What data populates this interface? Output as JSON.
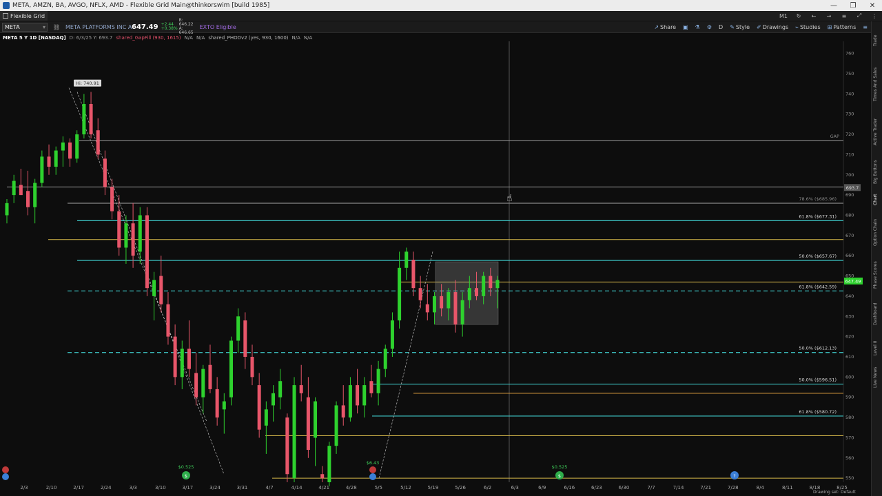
{
  "window": {
    "title": "META, AMZN, BA, AVGO, NFLX, AMD - Flexible Grid Main@thinkorswim [build 1985]",
    "minimize": "—",
    "restore": "❐",
    "close": "✕"
  },
  "menubar": {
    "grid_label": "Flexible Grid",
    "icons": [
      "M1",
      "↻",
      "←",
      "→",
      "≡",
      "⤢",
      "⋮"
    ]
  },
  "toolbar": {
    "symbol": "META",
    "company": "META PLATFORMS INC A",
    "last": "647.49",
    "change_abs": "+2.44",
    "change_pct": "+0.38%",
    "bid": "B: 646.22",
    "ask": "A: 646.65",
    "ext": "EXTO Eligible",
    "share": "Share",
    "style": "Style",
    "drawings": "Drawings",
    "studies": "Studies",
    "patterns": "Patterns",
    "timeframe": "D"
  },
  "chart_header": {
    "symbol": "META 5 Y 1D [NASDAQ]",
    "ohlc": "D: 6/3/25  Y: 693.7",
    "study1": "shared_GapFill (930, 1615)",
    "na1": "N/A",
    "na2": "N/A",
    "study2": "shared_PHODv2 (yes, 930, 1600)",
    "na3": "N/A",
    "na4": "N/A"
  },
  "sidebar": {
    "tabs": [
      "Trade",
      "Times And Sales",
      "Active Trader",
      "Big Buttons",
      "Chart",
      "Option Chain",
      "Phase Scores",
      "Dashboard",
      "Level II",
      "Live News"
    ]
  },
  "chart_data": {
    "type": "candlestick",
    "price_axis": {
      "ylim": [
        548,
        766
      ],
      "ticks": [
        550,
        560,
        570,
        580,
        590,
        600,
        610,
        620,
        630,
        640,
        650,
        660,
        670,
        680,
        690,
        700,
        710,
        720,
        730,
        740,
        750,
        760
      ]
    },
    "date_ticks": [
      "2/3",
      "2/10",
      "2/17",
      "2/24",
      "3/3",
      "3/10",
      "3/17",
      "3/24",
      "3/31",
      "4/7",
      "4/14",
      "4/21",
      "4/28",
      "5/5",
      "5/12",
      "5/19",
      "5/26",
      "6/2",
      "6/3",
      "6/9",
      "6/16",
      "6/23",
      "6/30",
      "7/7",
      "7/14",
      "7/21",
      "7/28",
      "8/4",
      "8/11",
      "8/18",
      "8/25"
    ],
    "high_label": "Hi: 740.91",
    "last_price": "647.49",
    "cursor_price": "693.7",
    "gap_label": "GAP",
    "fib_lines": [
      {
        "label": "78.6% ($685.96)",
        "price": 685.96,
        "color": "#888888",
        "style": "solid"
      },
      {
        "label": "61.8% ($677.31)",
        "price": 677.31,
        "color": "#3ec9c9",
        "style": "solid"
      },
      {
        "label": "50.0% ($657.67)",
        "price": 657.67,
        "color": "#3ec9c9",
        "style": "solid"
      },
      {
        "label": "61.8% ($642.59)",
        "price": 642.59,
        "color": "#3ec9c9",
        "style": "dashed"
      },
      {
        "label": "50.0% ($612.13)",
        "price": 612.13,
        "color": "#3ec9c9",
        "style": "dashed"
      },
      {
        "label": "50.0% ($596.51)",
        "price": 596.51,
        "color": "#3ec9c9",
        "style": "solid"
      },
      {
        "label": "61.8% ($580.72)",
        "price": 580.72,
        "color": "#3ec9c9",
        "style": "solid"
      }
    ],
    "level_lines": [
      {
        "price": 717,
        "color": "#9a9a9a"
      },
      {
        "price": 694,
        "color": "#9a9a9a"
      },
      {
        "price": 668,
        "color": "#d6b84a"
      },
      {
        "price": 647,
        "color": "#d6b84a"
      },
      {
        "price": 592,
        "color": "#e0a040"
      },
      {
        "price": 571,
        "color": "#d6b84a"
      },
      {
        "price": 550,
        "color": "#d6b84a"
      }
    ],
    "candles": [
      [
        680,
        688,
        676,
        686
      ],
      [
        690,
        700,
        686,
        697
      ],
      [
        695,
        703,
        690,
        690
      ],
      [
        692,
        702,
        680,
        684
      ],
      [
        684,
        698,
        676,
        696
      ],
      [
        696,
        712,
        694,
        709
      ],
      [
        709,
        715,
        700,
        704
      ],
      [
        704,
        714,
        700,
        712
      ],
      [
        712,
        719,
        704,
        716
      ],
      [
        716,
        718,
        704,
        708
      ],
      [
        708,
        722,
        706,
        720
      ],
      [
        720,
        740,
        718,
        735
      ],
      [
        735,
        741,
        718,
        720
      ],
      [
        722,
        728,
        708,
        710
      ],
      [
        708,
        712,
        690,
        694
      ],
      [
        694,
        698,
        678,
        682
      ],
      [
        682,
        690,
        660,
        664
      ],
      [
        664,
        680,
        656,
        676
      ],
      [
        676,
        686,
        654,
        660
      ],
      [
        662,
        684,
        656,
        680
      ],
      [
        680,
        684,
        640,
        644
      ],
      [
        640,
        652,
        628,
        648
      ],
      [
        650,
        660,
        632,
        636
      ],
      [
        636,
        642,
        616,
        620
      ],
      [
        620,
        626,
        596,
        600
      ],
      [
        600,
        618,
        594,
        614
      ],
      [
        614,
        628,
        600,
        604
      ],
      [
        602,
        612,
        586,
        590
      ],
      [
        590,
        606,
        582,
        604
      ],
      [
        606,
        616,
        592,
        594
      ],
      [
        594,
        600,
        576,
        580
      ],
      [
        584,
        592,
        572,
        588
      ],
      [
        590,
        620,
        586,
        618
      ],
      [
        618,
        634,
        612,
        630
      ],
      [
        628,
        632,
        604,
        610
      ],
      [
        610,
        616,
        596,
        600
      ],
      [
        596,
        602,
        570,
        574
      ],
      [
        576,
        588,
        562,
        584
      ],
      [
        586,
        596,
        578,
        592
      ],
      [
        590,
        604,
        584,
        598
      ],
      [
        580,
        582,
        548,
        552
      ],
      [
        550,
        600,
        548,
        596
      ],
      [
        596,
        606,
        588,
        592
      ],
      [
        590,
        600,
        560,
        564
      ],
      [
        570,
        590,
        556,
        588
      ],
      [
        552,
        556,
        548,
        550
      ],
      [
        548,
        568,
        546,
        566
      ],
      [
        566,
        588,
        562,
        586
      ],
      [
        586,
        596,
        576,
        580
      ],
      [
        580,
        600,
        578,
        596
      ],
      [
        596,
        604,
        582,
        586
      ],
      [
        586,
        600,
        580,
        596
      ],
      [
        598,
        606,
        590,
        592
      ],
      [
        592,
        608,
        586,
        604
      ],
      [
        604,
        616,
        600,
        614
      ],
      [
        614,
        632,
        610,
        628
      ],
      [
        628,
        662,
        624,
        654
      ],
      [
        654,
        664,
        648,
        662
      ],
      [
        658,
        662,
        640,
        644
      ],
      [
        644,
        650,
        634,
        638
      ],
      [
        636,
        646,
        628,
        632
      ],
      [
        632,
        642,
        626,
        640
      ],
      [
        640,
        646,
        630,
        634
      ],
      [
        634,
        644,
        628,
        642
      ],
      [
        642,
        648,
        622,
        626
      ],
      [
        626,
        642,
        620,
        638
      ],
      [
        638,
        650,
        634,
        644
      ],
      [
        644,
        652,
        638,
        640
      ],
      [
        640,
        652,
        636,
        650
      ],
      [
        650,
        654,
        640,
        644
      ],
      [
        644,
        650,
        634,
        648
      ]
    ],
    "dividends": [
      "$0.525",
      "$0.525",
      "$0.525"
    ],
    "earnings": "$6.43"
  },
  "bottom_status": "Drawing set: Default"
}
